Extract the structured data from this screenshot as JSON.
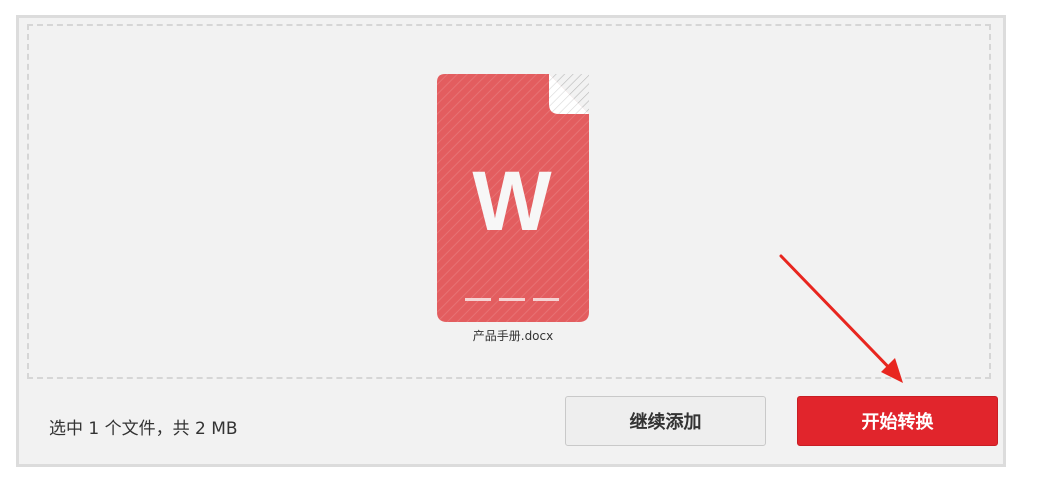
{
  "file": {
    "name": "产品手册.docx",
    "icon": "word-document-icon",
    "icon_letter": "W",
    "icon_color": "#e35d5f"
  },
  "footer": {
    "summary": "选中 1 个文件，共 2 MB",
    "add_more_label": "继续添加",
    "start_convert_label": "开始转换"
  },
  "colors": {
    "primary": "#e1252c",
    "panel_background": "#f2f2f2",
    "annotation_arrow": "#e8261f"
  }
}
